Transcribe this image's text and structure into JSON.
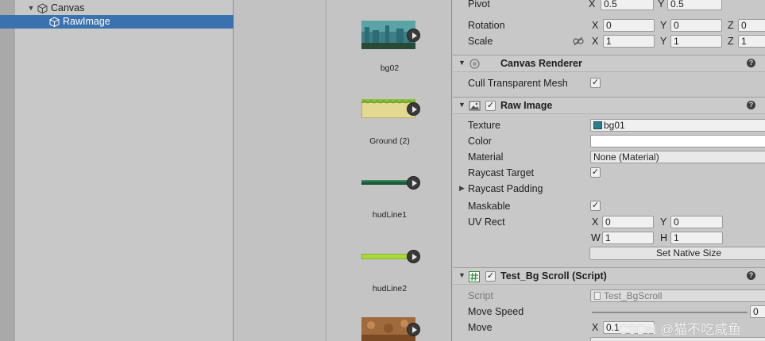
{
  "hierarchy": {
    "items": [
      {
        "label": "Canvas",
        "icon": "gameobject-cube-icon",
        "expanded": true
      },
      {
        "label": "RawImage",
        "icon": "gameobject-cube-icon",
        "selected": true
      }
    ]
  },
  "assets": [
    {
      "label": "bg02",
      "thumb": "bg02-thumbnail"
    },
    {
      "label": "Ground (2)",
      "thumb": "ground-thumbnail"
    },
    {
      "label": "hudLine1",
      "thumb": "hudline1-thumbnail"
    },
    {
      "label": "hudLine2",
      "thumb": "hudline2-thumbnail"
    },
    {
      "label": "",
      "thumb": "brown-thumbnail"
    }
  ],
  "inspector": {
    "rect_transform": {
      "pivot": {
        "label": "Pivot",
        "x": "0.5",
        "y": "0.5"
      },
      "rotation": {
        "label": "Rotation",
        "x": "0",
        "y": "0",
        "z": "0"
      },
      "scale": {
        "label": "Scale",
        "x": "1",
        "y": "1",
        "z": "1"
      },
      "axis_x": "X",
      "axis_y": "Y",
      "axis_z": "Z"
    },
    "canvas_renderer": {
      "title": "Canvas Renderer",
      "cull_label": "Cull Transparent Mesh",
      "cull_checked": "✓"
    },
    "raw_image": {
      "title": "Raw Image",
      "enabled_check": "✓",
      "texture_label": "Texture",
      "texture_value": "bg01",
      "color_label": "Color",
      "color_value": "#ffffff",
      "material_label": "Material",
      "material_value": "None (Material)",
      "raycast_target_label": "Raycast Target",
      "raycast_target_check": "✓",
      "raycast_padding_label": "Raycast Padding",
      "maskable_label": "Maskable",
      "maskable_check": "✓",
      "uvrect_label": "UV Rect",
      "uv_x": "0",
      "uv_y": "0",
      "uv_w": "1",
      "uv_h": "1",
      "axis_w": "W",
      "axis_h": "H",
      "native_size_button": "Set Native Size"
    },
    "script": {
      "title": "Test_Bg Scroll (Script)",
      "enabled_check": "✓",
      "script_label": "Script",
      "script_value": "Test_BgScroll",
      "move_speed_label": "Move Speed",
      "move_speed_value": "0",
      "move_label": "Move",
      "move_x": "0.1"
    },
    "help_glyph": "?",
    "ctx_glyph": "⋮"
  },
  "watermark": "CSDN @猫不吃咸鱼",
  "colors": {
    "selection": "#3a72b0",
    "panel": "#c8c8c8",
    "field": "#f0f0f0"
  }
}
